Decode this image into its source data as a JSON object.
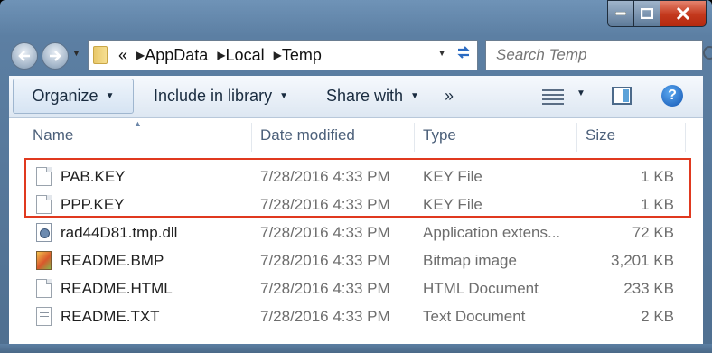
{
  "window": {
    "caption_buttons": [
      "minimize-icon",
      "maximize-icon",
      "close-icon"
    ]
  },
  "nav": {
    "back_icon": "back-arrow-icon",
    "forward_icon": "forward-arrow-icon"
  },
  "address": {
    "prefix": "«",
    "crumbs": [
      "AppData",
      "Local",
      "Temp"
    ],
    "refresh_icon": "refresh-icon"
  },
  "search": {
    "placeholder": "Search Temp"
  },
  "toolbar": {
    "organize_label": "Organize",
    "include_label": "Include in library",
    "share_label": "Share with",
    "more_label": "»",
    "help_label": "?"
  },
  "columns": {
    "name": "Name",
    "date": "Date modified",
    "type": "Type",
    "size": "Size"
  },
  "files": [
    {
      "name": "PAB.KEY",
      "date": "7/28/2016 4:33 PM",
      "type": "KEY File",
      "size": "1 KB",
      "icon": "blank-file-icon"
    },
    {
      "name": "PPP.KEY",
      "date": "7/28/2016 4:33 PM",
      "type": "KEY File",
      "size": "1 KB",
      "icon": "blank-file-icon"
    },
    {
      "name": "rad44D81.tmp.dll",
      "date": "7/28/2016 4:33 PM",
      "type": "Application extens...",
      "size": "72 KB",
      "icon": "dll-file-icon"
    },
    {
      "name": "README.BMP",
      "date": "7/28/2016 4:33 PM",
      "type": "Bitmap image",
      "size": "3,201 KB",
      "icon": "bitmap-file-icon"
    },
    {
      "name": "README.HTML",
      "date": "7/28/2016 4:33 PM",
      "type": "HTML Document",
      "size": "233 KB",
      "icon": "blank-file-icon"
    },
    {
      "name": "README.TXT",
      "date": "7/28/2016 4:33 PM",
      "type": "Text Document",
      "size": "2 KB",
      "icon": "text-file-icon"
    }
  ],
  "colors": {
    "highlight": "#e0391f",
    "title_bar": "#6f93b7"
  }
}
